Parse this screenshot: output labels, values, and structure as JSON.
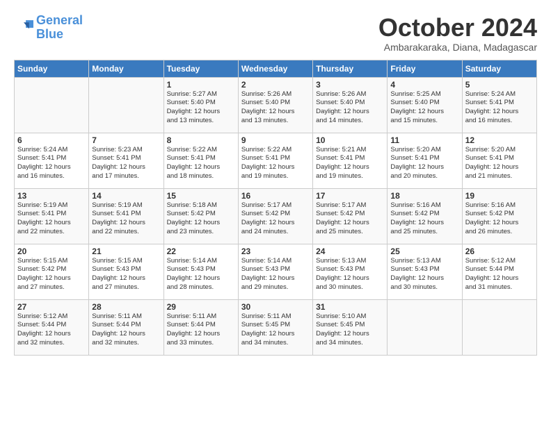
{
  "logo": {
    "line1": "General",
    "line2": "Blue"
  },
  "title": "October 2024",
  "subtitle": "Ambarakaraka, Diana, Madagascar",
  "days_header": [
    "Sunday",
    "Monday",
    "Tuesday",
    "Wednesday",
    "Thursday",
    "Friday",
    "Saturday"
  ],
  "weeks": [
    [
      {
        "num": "",
        "info": ""
      },
      {
        "num": "",
        "info": ""
      },
      {
        "num": "1",
        "info": "Sunrise: 5:27 AM\nSunset: 5:40 PM\nDaylight: 12 hours\nand 13 minutes."
      },
      {
        "num": "2",
        "info": "Sunrise: 5:26 AM\nSunset: 5:40 PM\nDaylight: 12 hours\nand 13 minutes."
      },
      {
        "num": "3",
        "info": "Sunrise: 5:26 AM\nSunset: 5:40 PM\nDaylight: 12 hours\nand 14 minutes."
      },
      {
        "num": "4",
        "info": "Sunrise: 5:25 AM\nSunset: 5:40 PM\nDaylight: 12 hours\nand 15 minutes."
      },
      {
        "num": "5",
        "info": "Sunrise: 5:24 AM\nSunset: 5:41 PM\nDaylight: 12 hours\nand 16 minutes."
      }
    ],
    [
      {
        "num": "6",
        "info": "Sunrise: 5:24 AM\nSunset: 5:41 PM\nDaylight: 12 hours\nand 16 minutes."
      },
      {
        "num": "7",
        "info": "Sunrise: 5:23 AM\nSunset: 5:41 PM\nDaylight: 12 hours\nand 17 minutes."
      },
      {
        "num": "8",
        "info": "Sunrise: 5:22 AM\nSunset: 5:41 PM\nDaylight: 12 hours\nand 18 minutes."
      },
      {
        "num": "9",
        "info": "Sunrise: 5:22 AM\nSunset: 5:41 PM\nDaylight: 12 hours\nand 19 minutes."
      },
      {
        "num": "10",
        "info": "Sunrise: 5:21 AM\nSunset: 5:41 PM\nDaylight: 12 hours\nand 19 minutes."
      },
      {
        "num": "11",
        "info": "Sunrise: 5:20 AM\nSunset: 5:41 PM\nDaylight: 12 hours\nand 20 minutes."
      },
      {
        "num": "12",
        "info": "Sunrise: 5:20 AM\nSunset: 5:41 PM\nDaylight: 12 hours\nand 21 minutes."
      }
    ],
    [
      {
        "num": "13",
        "info": "Sunrise: 5:19 AM\nSunset: 5:41 PM\nDaylight: 12 hours\nand 22 minutes."
      },
      {
        "num": "14",
        "info": "Sunrise: 5:19 AM\nSunset: 5:41 PM\nDaylight: 12 hours\nand 22 minutes."
      },
      {
        "num": "15",
        "info": "Sunrise: 5:18 AM\nSunset: 5:42 PM\nDaylight: 12 hours\nand 23 minutes."
      },
      {
        "num": "16",
        "info": "Sunrise: 5:17 AM\nSunset: 5:42 PM\nDaylight: 12 hours\nand 24 minutes."
      },
      {
        "num": "17",
        "info": "Sunrise: 5:17 AM\nSunset: 5:42 PM\nDaylight: 12 hours\nand 25 minutes."
      },
      {
        "num": "18",
        "info": "Sunrise: 5:16 AM\nSunset: 5:42 PM\nDaylight: 12 hours\nand 25 minutes."
      },
      {
        "num": "19",
        "info": "Sunrise: 5:16 AM\nSunset: 5:42 PM\nDaylight: 12 hours\nand 26 minutes."
      }
    ],
    [
      {
        "num": "20",
        "info": "Sunrise: 5:15 AM\nSunset: 5:42 PM\nDaylight: 12 hours\nand 27 minutes."
      },
      {
        "num": "21",
        "info": "Sunrise: 5:15 AM\nSunset: 5:43 PM\nDaylight: 12 hours\nand 27 minutes."
      },
      {
        "num": "22",
        "info": "Sunrise: 5:14 AM\nSunset: 5:43 PM\nDaylight: 12 hours\nand 28 minutes."
      },
      {
        "num": "23",
        "info": "Sunrise: 5:14 AM\nSunset: 5:43 PM\nDaylight: 12 hours\nand 29 minutes."
      },
      {
        "num": "24",
        "info": "Sunrise: 5:13 AM\nSunset: 5:43 PM\nDaylight: 12 hours\nand 30 minutes."
      },
      {
        "num": "25",
        "info": "Sunrise: 5:13 AM\nSunset: 5:43 PM\nDaylight: 12 hours\nand 30 minutes."
      },
      {
        "num": "26",
        "info": "Sunrise: 5:12 AM\nSunset: 5:44 PM\nDaylight: 12 hours\nand 31 minutes."
      }
    ],
    [
      {
        "num": "27",
        "info": "Sunrise: 5:12 AM\nSunset: 5:44 PM\nDaylight: 12 hours\nand 32 minutes."
      },
      {
        "num": "28",
        "info": "Sunrise: 5:11 AM\nSunset: 5:44 PM\nDaylight: 12 hours\nand 32 minutes."
      },
      {
        "num": "29",
        "info": "Sunrise: 5:11 AM\nSunset: 5:44 PM\nDaylight: 12 hours\nand 33 minutes."
      },
      {
        "num": "30",
        "info": "Sunrise: 5:11 AM\nSunset: 5:45 PM\nDaylight: 12 hours\nand 34 minutes."
      },
      {
        "num": "31",
        "info": "Sunrise: 5:10 AM\nSunset: 5:45 PM\nDaylight: 12 hours\nand 34 minutes."
      },
      {
        "num": "",
        "info": ""
      },
      {
        "num": "",
        "info": ""
      }
    ]
  ]
}
